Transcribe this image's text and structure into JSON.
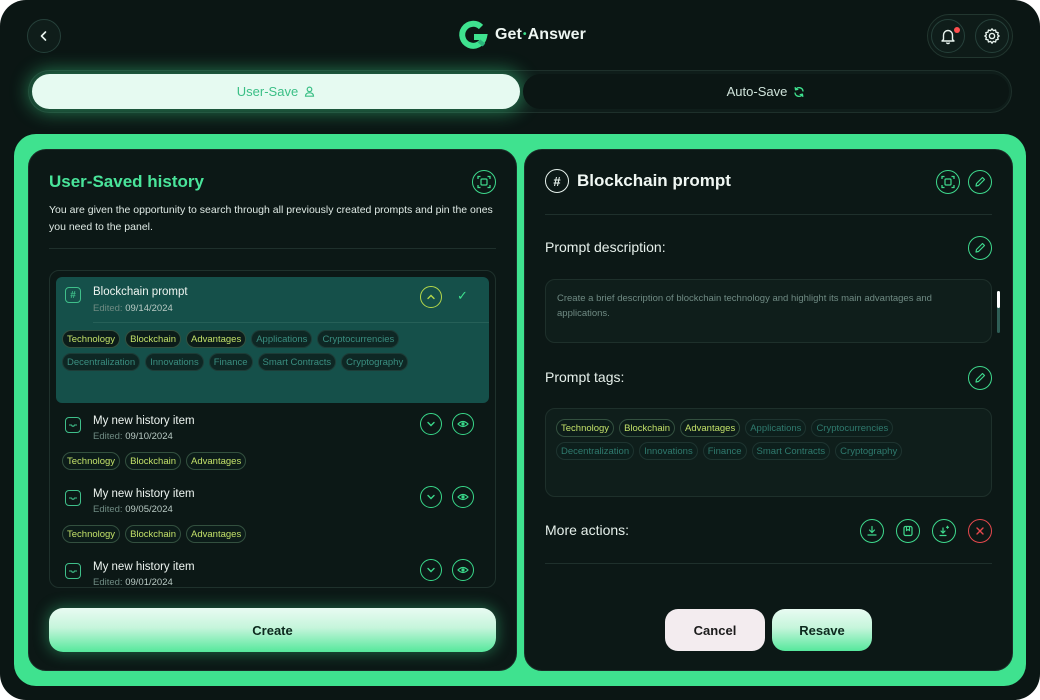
{
  "header": {
    "brand_name_1": "Get",
    "brand_separator": "•",
    "brand_name_2": "Answer"
  },
  "save_tabs": [
    {
      "label": "User-Save",
      "icon": "user-icon",
      "active": true
    },
    {
      "label": "Auto-Save",
      "icon": "refresh-icon",
      "active": false
    }
  ],
  "history": {
    "title": "User-Saved history",
    "description": "You are given the opportunity to search through all previously created prompts and pin the ones you need to the panel.",
    "edited_label": "Edited:",
    "items": [
      {
        "title": "Blockchain prompt",
        "date": "09/14/2024",
        "selected": true,
        "tags": [
          "Technology",
          "Blockchain",
          "Advantages",
          "Applications",
          "Cryptocurrencies",
          "Decentralization",
          "Innovations",
          "Finance",
          "Smart Contracts",
          "Cryptography"
        ]
      },
      {
        "title": "My new history item",
        "date": "09/10/2024",
        "selected": false,
        "tags": [
          "Technology",
          "Blockchain",
          "Advantages"
        ]
      },
      {
        "title": "My new history item",
        "date": "09/05/2024",
        "selected": false,
        "tags": [
          "Technology",
          "Blockchain",
          "Advantages"
        ]
      },
      {
        "title": "My new history item",
        "date": "09/01/2024",
        "selected": false,
        "tags": []
      }
    ],
    "create_label": "Create"
  },
  "detail": {
    "title": "Blockchain prompt",
    "description_label": "Prompt description:",
    "description_text": "Create a brief description of blockchain technology and highlight its main advantages and applications.",
    "tags_label": "Prompt tags:",
    "tags": [
      "Technology",
      "Blockchain",
      "Advantages",
      "Applications",
      "Cryptocurrencies",
      "Decentralization",
      "Innovations",
      "Finance",
      "Smart Contracts",
      "Cryptography"
    ],
    "more_actions_label": "More actions:",
    "cancel_label": "Cancel",
    "resave_label": "Resave"
  },
  "colors": {
    "accent": "#3fe28f",
    "background": "#0b1614",
    "selected_row": "#15504a",
    "danger": "#e5484d"
  }
}
